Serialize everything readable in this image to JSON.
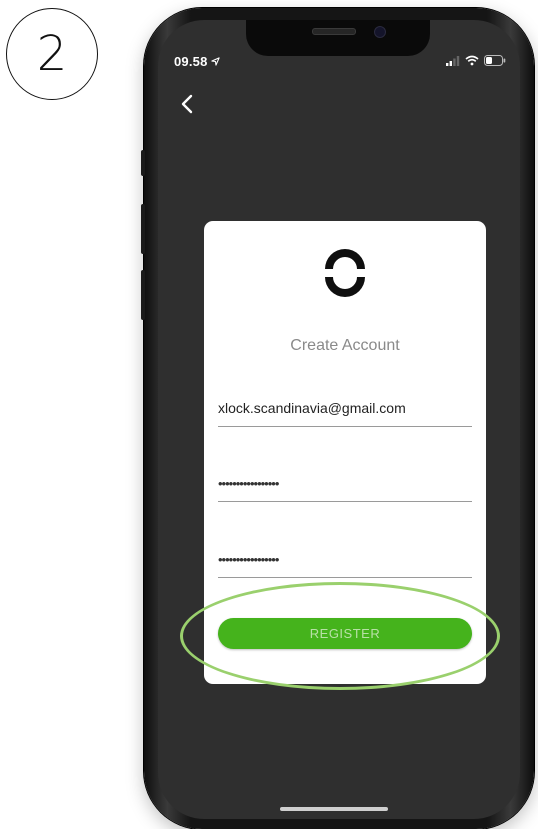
{
  "step": {
    "number": "2"
  },
  "status_bar": {
    "time": "09.58"
  },
  "navigation": {
    "back_icon": "chevron-left-icon"
  },
  "card": {
    "logo_icon": "app-logo-icon",
    "title": "Create Account",
    "email_value": "xlock.scandinavia@gmail.com",
    "password_value": "•••••••••••••••••",
    "confirm_password_value": "•••••••••••••••••",
    "register_label": "REGISTER"
  },
  "colors": {
    "screen_background": "#2f2f2f",
    "card_background": "#ffffff",
    "register_button": "#45b31c",
    "highlight_ring": "#9ad06d"
  }
}
